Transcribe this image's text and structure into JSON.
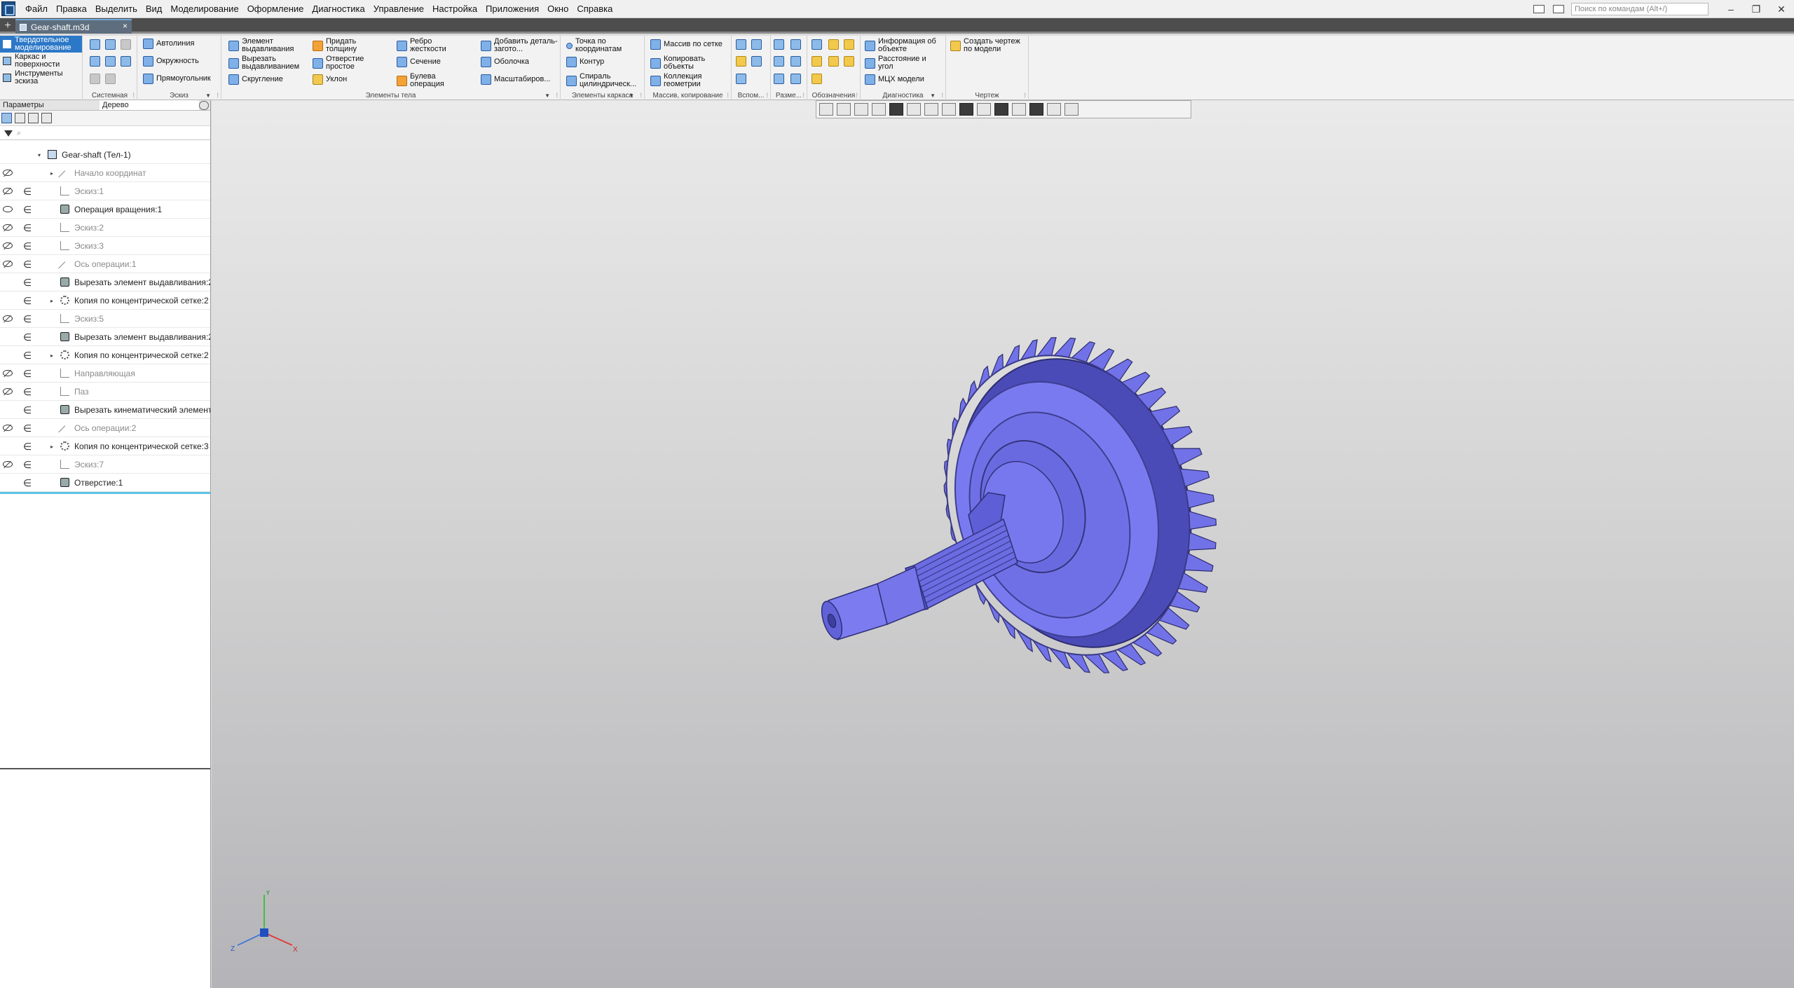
{
  "app": {
    "logo_icon": "kompas-logo-icon"
  },
  "menu": [
    "Файл",
    "Правка",
    "Выделить",
    "Вид",
    "Моделирование",
    "Оформление",
    "Диагностика",
    "Управление",
    "Настройка",
    "Приложения",
    "Окно",
    "Справка"
  ],
  "command_search": {
    "placeholder": "Поиск по командам (Alt+/)"
  },
  "window_controls": {
    "minimize": "‒",
    "restore": "❐",
    "close": "✕"
  },
  "tabs": {
    "add": "+",
    "document": "Gear-shaft.m3d",
    "close": "×"
  },
  "ribbon": {
    "modes": [
      "Твердотельное моделирование",
      "Каркас и поверхности",
      "Инструменты эскиза"
    ],
    "group_titles": {
      "system": "Системная",
      "sketch": "Эскиз",
      "body": "Элементы тела",
      "frame": "Элементы каркаса",
      "array": "Массив, копирование",
      "aux": "Вспом...",
      "dims": "Разме...",
      "notes": "Обозначения",
      "diag": "Диагностика",
      "drawing": "Чертеж"
    },
    "sketch": [
      "Автолиния",
      "Окружность",
      "Прямоугольник"
    ],
    "body_col1": [
      "Элемент выдавливания",
      "Вырезать выдавливанием",
      "Скругление"
    ],
    "body_col2": [
      "Придать толщину",
      "Отверстие простое",
      "Уклон"
    ],
    "body_col3": [
      "Ребро жесткости",
      "Сечение",
      "Булева операция"
    ],
    "body_col4": [
      "Добавить деталь-загото...",
      "Оболочка",
      "Масштабиров..."
    ],
    "frame": [
      "Точка по координатам",
      "Контур",
      "Спираль цилиндрическ..."
    ],
    "array": [
      "Массив по сетке",
      "Копировать объекты",
      "Коллекция геометрии"
    ],
    "diag": [
      "Информация об объекте",
      "Расстояние и угол",
      "МЦХ модели"
    ],
    "drawing": [
      "Создать чертеж по модели"
    ]
  },
  "panel": {
    "tabs": [
      "Параметры",
      "Дерево"
    ],
    "filter_placeholder": "⌕"
  },
  "tree": [
    {
      "label": "Gear-shaft (Тел-1)",
      "level": 0,
      "icon": "part-icon",
      "eye": "",
      "embed": false,
      "expand": "▾",
      "grey": false
    },
    {
      "label": "Начало координат",
      "level": 1,
      "icon": "origin-icon",
      "eye": "hidden",
      "embed": false,
      "expand": "▸",
      "grey": true
    },
    {
      "label": "Эскиз:1",
      "level": 1,
      "icon": "sketch-icon",
      "eye": "hidden",
      "embed": true,
      "expand": "",
      "grey": true
    },
    {
      "label": "Операция вращения:1",
      "level": 1,
      "icon": "revolve-icon",
      "eye": "visible",
      "embed": true,
      "expand": "",
      "grey": false
    },
    {
      "label": "Эскиз:2",
      "level": 1,
      "icon": "sketch-icon",
      "eye": "hidden",
      "embed": true,
      "expand": "",
      "grey": true
    },
    {
      "label": "Эскиз:3",
      "level": 1,
      "icon": "sketch-icon",
      "eye": "hidden",
      "embed": true,
      "expand": "",
      "grey": true
    },
    {
      "label": "Ось операции:1",
      "level": 1,
      "icon": "axis-icon",
      "eye": "hidden",
      "embed": true,
      "expand": "",
      "grey": true
    },
    {
      "label": "Вырезать элемент выдавливания:2",
      "level": 1,
      "icon": "cut-extrude-icon",
      "eye": "",
      "embed": true,
      "expand": "",
      "grey": false
    },
    {
      "label": "Копия по концентрической сетке:2",
      "level": 1,
      "icon": "circular-array-icon",
      "eye": "",
      "embed": true,
      "expand": "▸",
      "grey": false
    },
    {
      "label": "Эскиз:5",
      "level": 1,
      "icon": "sketch-icon",
      "eye": "hidden",
      "embed": true,
      "expand": "",
      "grey": true
    },
    {
      "label": "Вырезать элемент выдавливания:2",
      "level": 1,
      "icon": "cut-extrude-icon",
      "eye": "",
      "embed": true,
      "expand": "",
      "grey": false
    },
    {
      "label": "Копия по концентрической сетке:2",
      "level": 1,
      "icon": "circular-array-icon",
      "eye": "",
      "embed": true,
      "expand": "▸",
      "grey": false
    },
    {
      "label": "Направляющая",
      "level": 1,
      "icon": "sketch-icon",
      "eye": "hidden",
      "embed": true,
      "expand": "",
      "grey": true
    },
    {
      "label": "Паз",
      "level": 1,
      "icon": "sketch-icon",
      "eye": "hidden",
      "embed": true,
      "expand": "",
      "grey": true
    },
    {
      "label": "Вырезать кинематический элемент",
      "level": 1,
      "icon": "cut-sweep-icon",
      "eye": "",
      "embed": true,
      "expand": "",
      "grey": false
    },
    {
      "label": "Ось операции:2",
      "level": 1,
      "icon": "axis-icon",
      "eye": "hidden",
      "embed": true,
      "expand": "",
      "grey": true
    },
    {
      "label": "Копия по концентрической сетке:3",
      "level": 1,
      "icon": "circular-array-icon",
      "eye": "",
      "embed": true,
      "expand": "▸",
      "grey": false
    },
    {
      "label": "Эскиз:7",
      "level": 1,
      "icon": "sketch-icon",
      "eye": "hidden",
      "embed": true,
      "expand": "",
      "grey": true
    },
    {
      "label": "Отверстие:1",
      "level": 1,
      "icon": "hole-icon",
      "eye": "",
      "embed": true,
      "expand": "",
      "grey": false
    }
  ],
  "triad": {
    "x": "X",
    "y": "Y",
    "z": "Z"
  },
  "colors": {
    "model": "#7272e8",
    "model_dark": "#4b4bb8",
    "accent": "#2c78c8",
    "tree_end": "#5fc4e8"
  }
}
